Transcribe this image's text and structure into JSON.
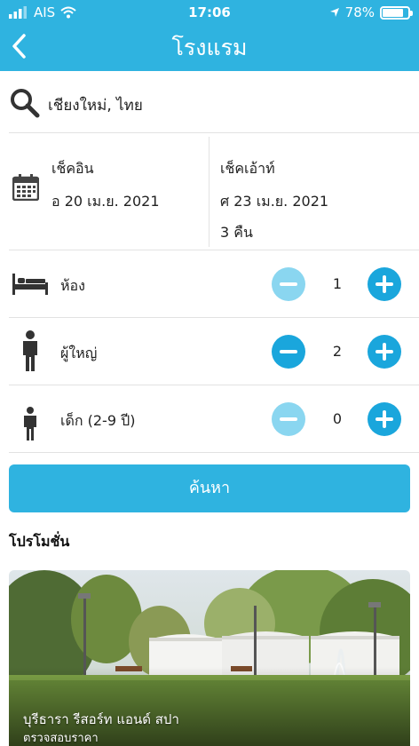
{
  "status": {
    "carrier": "AIS",
    "time": "17:06",
    "battery": "78%"
  },
  "header": {
    "title": "โรงแรม"
  },
  "search": {
    "location": "เชียงใหม่, ไทย"
  },
  "dates": {
    "checkin_label": "เช็คอิน",
    "checkin_value": "อ 20 เม.ย. 2021",
    "checkout_label": "เช็คเอ้าท์",
    "checkout_value": "ศ 23 เม.ย. 2021",
    "nights": "3 คืน"
  },
  "counters": [
    {
      "label": "ห้อง",
      "value": "1"
    },
    {
      "label": "ผู้ใหญ่",
      "value": "2"
    },
    {
      "label": "เด็ก (2-9 ปี)",
      "value": "0"
    }
  ],
  "search_button": {
    "label": "ค้นหา"
  },
  "promotions": {
    "title": "โปรโมชั่น",
    "card": {
      "name": "บุรีธารา รีสอร์ท แอนด์ สปา",
      "subtitle": "ตรวจสอบราคา"
    }
  },
  "colors": {
    "primary": "#2fb3e0",
    "button": "#1aa6dc",
    "button_disabled": "#8ad6f0"
  }
}
